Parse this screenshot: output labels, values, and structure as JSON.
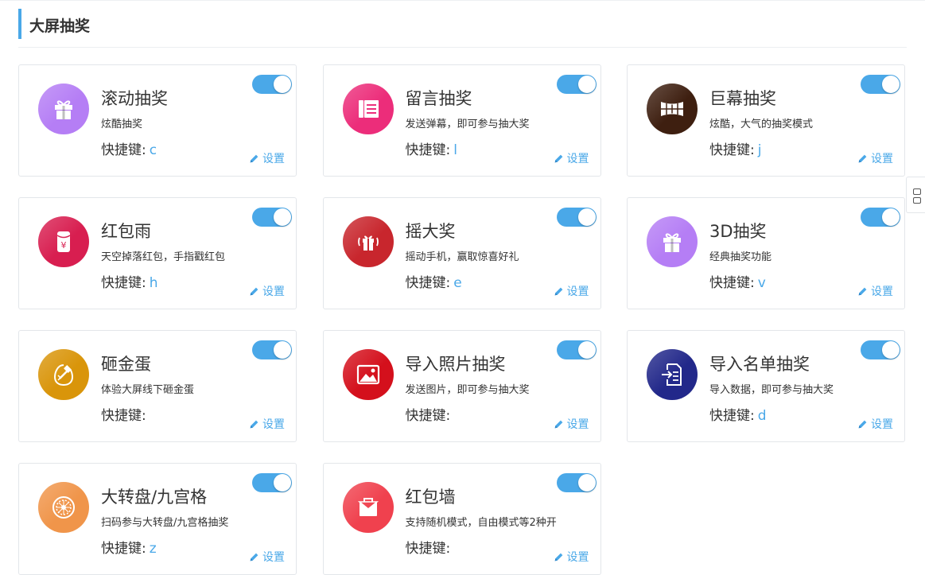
{
  "section": {
    "title": "大屏抽奖"
  },
  "labels": {
    "shortcut": "快捷键:",
    "settings": "设置"
  },
  "colors": {
    "accent": "#4aa8e8"
  },
  "cards": [
    {
      "name": "滚动抽奖",
      "desc": "炫酷抽奖",
      "key": "c",
      "icon": "gift-icon",
      "color": "#b57ef5",
      "enabled": true
    },
    {
      "name": "留言抽奖",
      "desc": "发送弹幕，即可参与抽大奖",
      "key": "l",
      "icon": "message-board-icon",
      "color": "#ec2d7a",
      "enabled": true
    },
    {
      "name": "巨幕抽奖",
      "desc": "炫酷，大气的抽奖模式",
      "key": "j",
      "icon": "curved-screen-icon",
      "color": "#3e1f10",
      "enabled": true
    },
    {
      "name": "红包雨",
      "desc": "天空掉落红包，手指戳红包",
      "key": "h",
      "icon": "red-envelope-icon",
      "color": "#d81e50",
      "enabled": true
    },
    {
      "name": "摇大奖",
      "desc": "摇动手机，赢取惊喜好礼",
      "key": "e",
      "icon": "shaking-gift-icon",
      "color": "#c8262d",
      "enabled": true
    },
    {
      "name": "3D抽奖",
      "desc": "经典抽奖功能",
      "key": "v",
      "icon": "gift-icon",
      "color": "#b57ef5",
      "enabled": true
    },
    {
      "name": "砸金蛋",
      "desc": "体验大屏线下砸金蛋",
      "key": "",
      "icon": "golden-egg-hammer-icon",
      "color": "#d9950a",
      "enabled": true
    },
    {
      "name": "导入照片抽奖",
      "desc": "发送图片，即可参与抽大奖",
      "key": "",
      "icon": "photo-icon",
      "color": "#d4101c",
      "enabled": true
    },
    {
      "name": "导入名单抽奖",
      "desc": "导入数据，即可参与抽大奖",
      "key": "d",
      "icon": "import-list-icon",
      "color": "#22288a",
      "enabled": true
    },
    {
      "name": "大转盘/九宫格",
      "desc": "扫码参与大转盘/九宫格抽奖",
      "key": "z",
      "icon": "wheel-icon",
      "color": "#f0954a",
      "enabled": true
    },
    {
      "name": "红包墙",
      "desc": "支持随机模式，自由模式等2种开",
      "key": "",
      "icon": "red-packet-wall-icon",
      "color": "#f0414e",
      "enabled": true
    }
  ]
}
